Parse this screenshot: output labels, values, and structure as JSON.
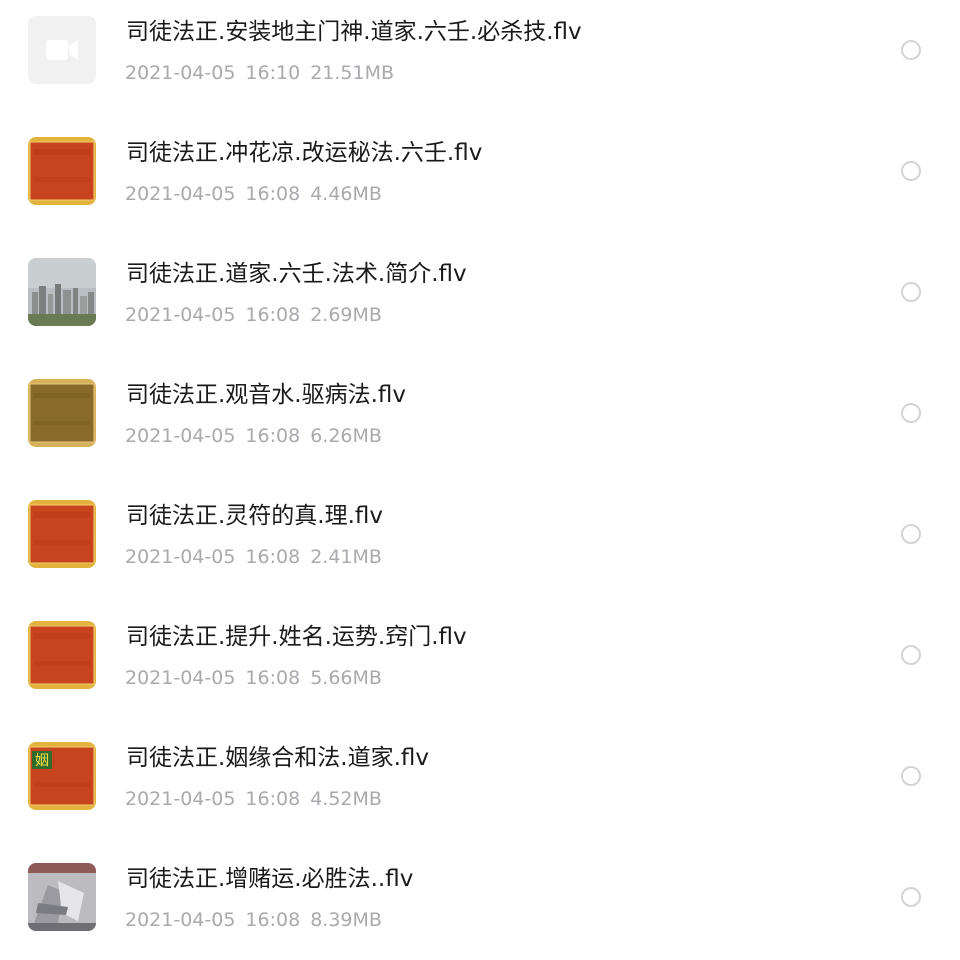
{
  "files": [
    {
      "name": "司徒法正.安装地主门神.道家.六壬.必杀技.flv",
      "date": "2021-04-05",
      "time": "16:10",
      "size": "21.51MB",
      "thumbnail": "video-placeholder-icon"
    },
    {
      "name": "司徒法正.冲花凉.改运秘法.六壬.flv",
      "date": "2021-04-05",
      "time": "16:08",
      "size": "4.46MB",
      "thumbnail": "red-gold-frame"
    },
    {
      "name": "司徒法正.道家.六壬.法术.简介.flv",
      "date": "2021-04-05",
      "time": "16:08",
      "size": "2.69MB",
      "thumbnail": "city-skyline"
    },
    {
      "name": "司徒法正.观音水.驱病法.flv",
      "date": "2021-04-05",
      "time": "16:08",
      "size": "6.26MB",
      "thumbnail": "brown-gold-frame"
    },
    {
      "name": "司徒法正.灵符的真.理.flv",
      "date": "2021-04-05",
      "time": "16:08",
      "size": "2.41MB",
      "thumbnail": "red-gold-frame"
    },
    {
      "name": "司徒法正.提升.姓名.运势.窍门.flv",
      "date": "2021-04-05",
      "time": "16:08",
      "size": "5.66MB",
      "thumbnail": "red-gold-frame"
    },
    {
      "name": "司徒法正.姻缘合和法.道家.flv",
      "date": "2021-04-05",
      "time": "16:08",
      "size": "4.52MB",
      "thumbnail": "red-gold-frame-badge",
      "thumbnail_badge": "姻"
    },
    {
      "name": "司徒法正.增赌运.必胜法..flv",
      "date": "2021-04-05",
      "time": "16:08",
      "size": "8.39MB",
      "thumbnail": "grey-photo"
    }
  ],
  "colors": {
    "name_text": "#1a1a1a",
    "meta_text": "#a9a9ae",
    "radio_border": "#d4d4d8",
    "placeholder_bg": "#f1f1f1",
    "placeholder_icon": "#ffffff",
    "red_thumb": "#c8441f",
    "gold_border": "#e2b23c",
    "brown_thumb": "#8a6a2a"
  }
}
